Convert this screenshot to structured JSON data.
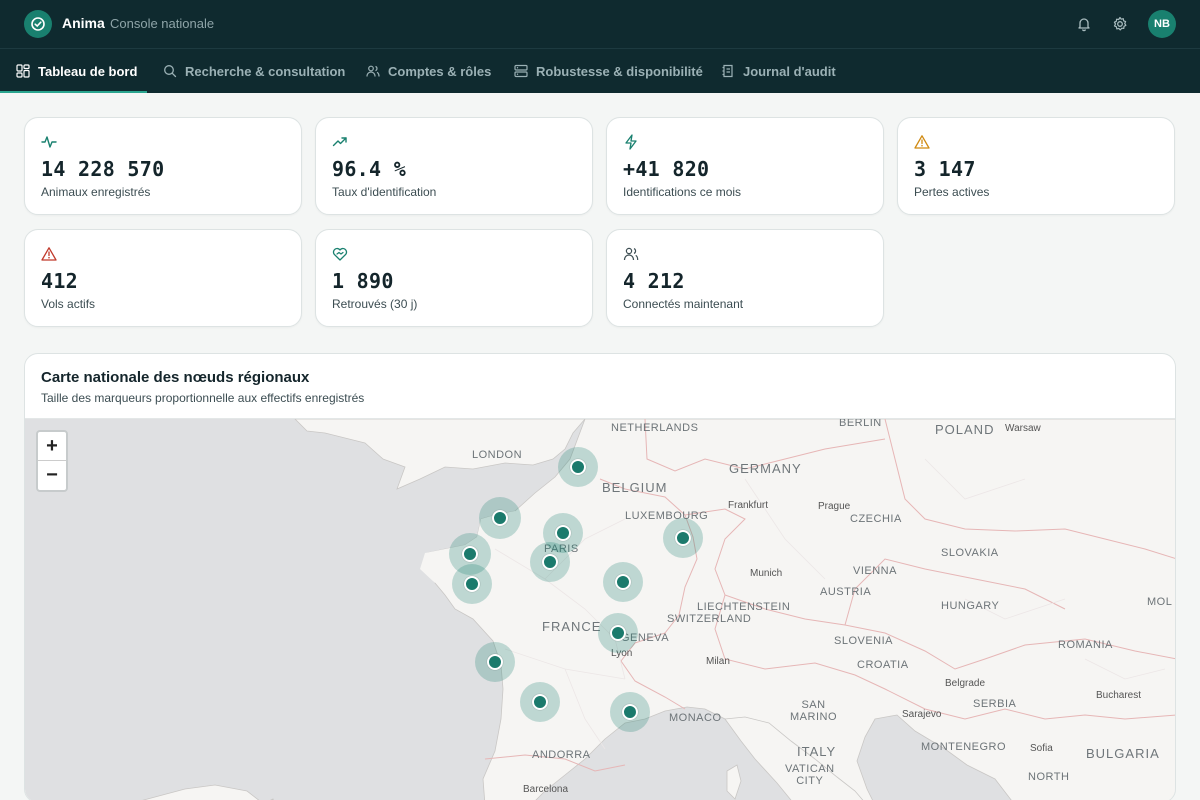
{
  "header": {
    "app_name": "Anima",
    "app_subtitle": "Console nationale",
    "icons": [
      "bell-icon",
      "gear-icon"
    ],
    "avatar_initials": "NB",
    "colors": {
      "bar": "#0f2a2f",
      "accent": "#19806f"
    }
  },
  "nav": {
    "tabs": [
      {
        "label": "Tableau de bord",
        "icon": "dashboard-icon",
        "active": true
      },
      {
        "label": "Recherche & consultation",
        "icon": "search-icon",
        "active": false
      },
      {
        "label": "Comptes & rôles",
        "icon": "users-icon",
        "active": false
      },
      {
        "label": "Robustesse & disponibilité",
        "icon": "server-icon",
        "active": false
      },
      {
        "label": "Journal d'audit",
        "icon": "audit-log-icon",
        "active": false
      }
    ]
  },
  "stats": [
    {
      "value": "14 228 570",
      "label": "Animaux enregistrés",
      "icon": "activity-icon",
      "color": "#19806f"
    },
    {
      "value": "96.4 %",
      "label": "Taux d'identification",
      "icon": "trending-up-icon",
      "color": "#19806f"
    },
    {
      "value": "+41 820",
      "label": "Identifications ce mois",
      "icon": "zap-icon",
      "color": "#19806f"
    },
    {
      "value": "3 147",
      "label": "Pertes actives",
      "icon": "warning-icon",
      "color": "#d08a12"
    },
    {
      "value": "412",
      "label": "Vols actifs",
      "icon": "alert-icon",
      "color": "#c0392b"
    },
    {
      "value": "1 890",
      "label": "Retrouvés (30 j)",
      "icon": "heart-handshake-icon",
      "color": "#19806f"
    },
    {
      "value": "4 212",
      "label": "Connectés maintenant",
      "icon": "users-icon",
      "color": "#3c4d52"
    }
  ],
  "map_panel": {
    "title": "Carte nationale des nœuds régionaux",
    "subtitle": "Taille des marqueurs proportionnelle aux effectifs enregistrés",
    "zoom_in": "+",
    "zoom_out": "−",
    "labels": {
      "netherlands": "NETHERLANDS",
      "berlin": "BERLIN",
      "poland": "POLAND",
      "warsaw": "Warsaw",
      "london": "LONDON",
      "germany": "GERMANY",
      "belgium": "BELGIUM",
      "frankfurt": "Frankfurt",
      "prague": "Prague",
      "luxembourg": "LUXEMBOURG",
      "czechia": "CZECHIA",
      "paris": "PARIS",
      "slovakia": "SLOVAKIA",
      "munich": "Munich",
      "vienna": "VIENNA",
      "austria": "AUSTRIA",
      "liechtenstein": "LIECHTENSTEIN",
      "switzerland": "SWITZERLAND",
      "hungary": "HUNGARY",
      "moldova": "MOL",
      "france": "FRANCE",
      "geneva": "GENEVA",
      "slovenia": "SLOVENIA",
      "romania": "ROMANIA",
      "lyon": "Lyon",
      "milan": "Milan",
      "croatia": "CROATIA",
      "belgrade": "Belgrade",
      "bucharest": "Bucharest",
      "san_marino": "SAN\nMARINO",
      "serbia": "SERBIA",
      "monaco": "MONACO",
      "sarajevo": "Sarajevo",
      "italy": "ITALY",
      "montenegro": "MONTENEGRO",
      "sofia": "Sofia",
      "bulgaria": "BULGARIA",
      "vatican": "VATICAN\nCITY",
      "andorra": "ANDORRA",
      "north": "NORTH",
      "barcelona": "Barcelona"
    }
  }
}
